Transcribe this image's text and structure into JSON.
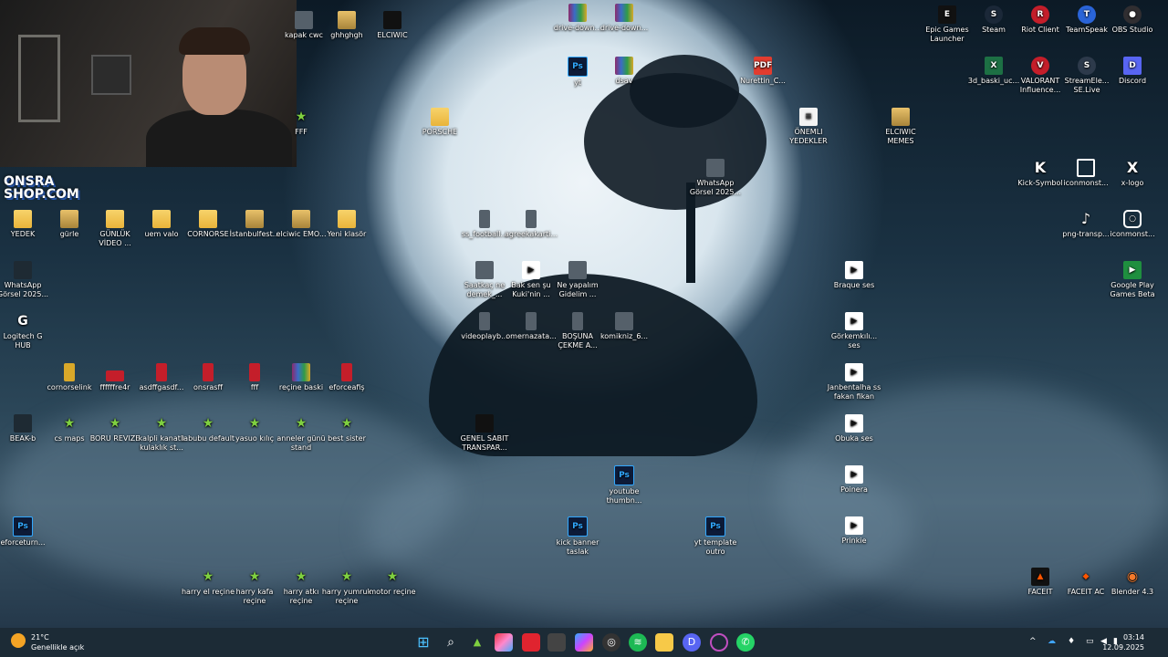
{
  "desktop_icons": {
    "top_row": [
      {
        "label": "kapak cwc",
        "icon": "image-icon"
      },
      {
        "label": "ghhghgh",
        "icon": "image-icon"
      },
      {
        "label": "ELCIWIC",
        "icon": "logo-icon"
      },
      {
        "label": "drive-down...",
        "icon": "rar-icon"
      },
      {
        "label": "drive-down...",
        "icon": "rar-icon"
      }
    ],
    "ps_yt": {
      "label": "yt",
      "icon": "psd-icon"
    },
    "dsav": {
      "label": "dsav",
      "icon": "rar-icon"
    },
    "nurettin": {
      "label": "Nurettin_C...",
      "icon": "pdf-icon"
    },
    "fff_top": {
      "label": "FFF",
      "icon": "stl-icon"
    },
    "porsche": {
      "label": "PORSCHE",
      "icon": "folder-icon"
    },
    "onemli": {
      "label": "ÖNEMLI YEDEKLER",
      "icon": "document-icon"
    },
    "elciwic_memes": {
      "label": "ELCIWIC MEMES",
      "icon": "folder-icon"
    },
    "whatsapp_center": {
      "label": "WhatsApp Görsel 2025...",
      "icon": "image-icon"
    },
    "epic": {
      "label": "Epic Games Launcher",
      "icon": "epic-games-icon"
    },
    "steam": {
      "label": "Steam",
      "icon": "steam-icon"
    },
    "riot": {
      "label": "Riot Client",
      "icon": "riot-icon"
    },
    "teamspeak": {
      "label": "TeamSpeak",
      "icon": "teamspeak-icon"
    },
    "obs": {
      "label": "OBS Studio",
      "icon": "obs-icon"
    },
    "baski": {
      "label": "3d_baski_uc...",
      "icon": "excel-icon"
    },
    "valorant": {
      "label": "VALORANT Influence...",
      "icon": "valorant-icon"
    },
    "streamelements": {
      "label": "StreamEle... SE.Live",
      "icon": "streamelements-icon"
    },
    "discord": {
      "label": "Discord",
      "icon": "discord-icon"
    },
    "kick": {
      "label": "Kick-Symbol",
      "icon": "kick-icon"
    },
    "iconmonst1": {
      "label": "iconmonst...",
      "icon": "twitch-icon"
    },
    "xlogo": {
      "label": "x-logo",
      "icon": "x-icon"
    },
    "pngtransp": {
      "label": "png-transp...",
      "icon": "tiktok-icon"
    },
    "iconmonst2": {
      "label": "iconmonst...",
      "icon": "instagram-icon"
    },
    "googleplay": {
      "label": "Google Play Games Beta",
      "icon": "google-play-icon"
    },
    "row_folders": [
      {
        "label": "YEDEK",
        "icon": "folder-icon"
      },
      {
        "label": "gürle",
        "icon": "folder-icon"
      },
      {
        "label": "GÜNLÜK VİDEO ...",
        "icon": "folder-icon"
      },
      {
        "label": "uem valo",
        "icon": "folder-icon"
      },
      {
        "label": "CORNORSE",
        "icon": "folder-icon"
      },
      {
        "label": "İstanbulfest...",
        "icon": "folder-icon"
      },
      {
        "label": "elciwic EMO...",
        "icon": "folder-icon"
      },
      {
        "label": "Yeni klasör",
        "icon": "folder-icon"
      }
    ],
    "center_files": [
      {
        "label": "ss_football...",
        "icon": "image-icon"
      },
      {
        "label": "agreekakarti...",
        "icon": "image-icon"
      },
      {
        "label": "Saatkaç ne demek_...",
        "icon": "image-icon"
      },
      {
        "label": "Bak sen şu Kuki'nin ...",
        "icon": "video-icon"
      },
      {
        "label": "Ne yapalım Gidelim ...",
        "icon": "image-icon"
      },
      {
        "label": "videoplayb...",
        "icon": "image-icon"
      },
      {
        "label": "omernazata...",
        "icon": "image-icon"
      },
      {
        "label": "BOŞUNA ÇEKME A...",
        "icon": "image-icon"
      },
      {
        "label": "komikniz_6...",
        "icon": "image-icon"
      }
    ],
    "left_col": [
      {
        "label": "WhatsApp Görsel 2025...",
        "icon": "image-icon"
      },
      {
        "label": "Logitech G HUB",
        "icon": "logitech-icon"
      }
    ],
    "stl_row1": [
      {
        "label": "cornorselink",
        "icon": "file-icon"
      },
      {
        "label": "ffffffre4r",
        "icon": "rar-icon"
      },
      {
        "label": "asdffgasdf...",
        "icon": "rar-icon"
      },
      {
        "label": "onsrasff",
        "icon": "rar-icon"
      },
      {
        "label": "fff",
        "icon": "rar-icon"
      },
      {
        "label": "reçine baski",
        "icon": "rar-icon"
      },
      {
        "label": "eforceafiş",
        "icon": "rar-icon"
      }
    ],
    "stl_row2": [
      {
        "label": "BEAK-b",
        "icon": "image-icon"
      },
      {
        "label": "cs maps",
        "icon": "stl-icon"
      },
      {
        "label": "BORU REVIZE",
        "icon": "stl-icon"
      },
      {
        "label": "kalpli kanatlı kulaklık st...",
        "icon": "stl-icon"
      },
      {
        "label": "labubu default",
        "icon": "stl-icon"
      },
      {
        "label": "yasuo kılıç",
        "icon": "stl-icon"
      },
      {
        "label": "anneler günü stand",
        "icon": "stl-icon"
      },
      {
        "label": "best sister",
        "icon": "stl-icon"
      }
    ],
    "genel": {
      "label": "GENEL SABIT TRANSPAR...",
      "icon": "image-icon"
    },
    "youtube_thumb": {
      "label": "youtube thumbn...",
      "icon": "psd-icon"
    },
    "eforceturn": {
      "label": "eforceturn...",
      "icon": "psd-icon"
    },
    "kick_banner": {
      "label": "kick banner taslak",
      "icon": "psd-icon"
    },
    "yt_template": {
      "label": "yt template outro",
      "icon": "psd-icon"
    },
    "sound_files": [
      {
        "label": "Braque ses",
        "icon": "video-icon"
      },
      {
        "label": "Görkemkılı... ses",
        "icon": "video-icon"
      },
      {
        "label": "Janbentalha ss fakan fikan",
        "icon": "video-icon"
      },
      {
        "label": "Obuka ses",
        "icon": "video-icon"
      },
      {
        "label": "Poinera",
        "icon": "video-icon"
      },
      {
        "label": "Prinkie",
        "icon": "video-icon"
      }
    ],
    "stl_row3": [
      {
        "label": "harry el reçine",
        "icon": "stl-icon"
      },
      {
        "label": "harry kafa reçine",
        "icon": "stl-icon"
      },
      {
        "label": "harry atkı reçine",
        "icon": "stl-icon"
      },
      {
        "label": "harry yumruk reçine",
        "icon": "stl-icon"
      },
      {
        "label": "motor reçine",
        "icon": "stl-icon"
      }
    ],
    "bottom_right": [
      {
        "label": "FACEIT",
        "icon": "faceit-icon"
      },
      {
        "label": "FACEIT AC",
        "icon": "faceit-ac-icon"
      },
      {
        "label": "Blender 4.3",
        "icon": "blender-icon"
      }
    ]
  },
  "logo_text": {
    "line1": "ONSRA",
    "line2": "SHOP.COM"
  },
  "taskbar": {
    "weather_temp": "21°C",
    "weather_desc": "Genellikle açık",
    "time": "03:14",
    "date": "12.09.2025"
  }
}
